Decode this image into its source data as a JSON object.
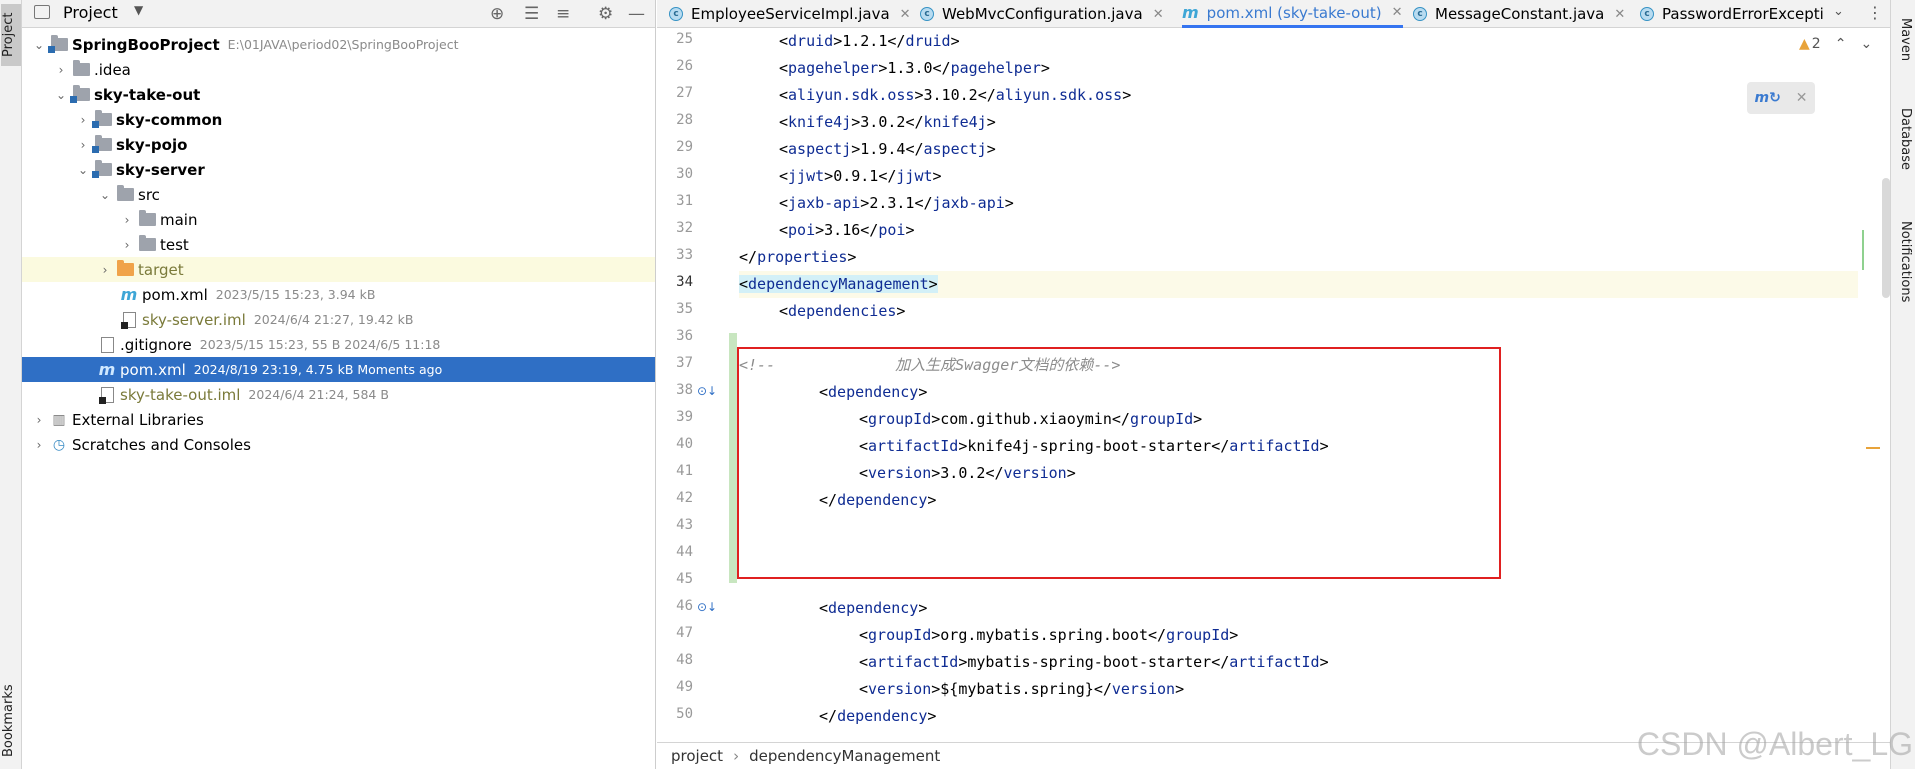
{
  "left_strip": {
    "project": "Project",
    "bookmarks": "Bookmarks"
  },
  "project_panel": {
    "title": "Project"
  },
  "tree": [
    {
      "label": "SpringBooProject",
      "meta": "E:\\01JAVA\\period02\\SpringBooProject",
      "icon": "module-folder-icon",
      "bold": true
    },
    {
      "label": ".idea",
      "meta": "",
      "icon": "folder-icon"
    },
    {
      "label": "sky-take-out",
      "meta": "",
      "icon": "module-folder-icon",
      "bold": true
    },
    {
      "label": "sky-common",
      "meta": "",
      "icon": "module-folder-icon",
      "bold": true
    },
    {
      "label": "sky-pojo",
      "meta": "",
      "icon": "module-folder-icon",
      "bold": true
    },
    {
      "label": "sky-server",
      "meta": "",
      "icon": "module-folder-icon",
      "bold": true
    },
    {
      "label": "src",
      "meta": "",
      "icon": "folder-icon"
    },
    {
      "label": "main",
      "meta": "",
      "icon": "folder-icon"
    },
    {
      "label": "test",
      "meta": "",
      "icon": "folder-icon"
    },
    {
      "label": "target",
      "meta": "",
      "icon": "target-folder-icon"
    },
    {
      "label": "pom.xml",
      "meta": "2023/5/15 15:23, 3.94 kB",
      "icon": "maven-file-icon"
    },
    {
      "label": "sky-server.iml",
      "meta": "2024/6/4 21:27, 19.42 kB",
      "icon": "iml-file-icon"
    },
    {
      "label": ".gitignore",
      "meta": "2023/5/15 15:23, 55 B 2024/6/5 11:18",
      "icon": "gitignore-file-icon"
    },
    {
      "label": "pom.xml",
      "meta": "2024/8/19 23:19, 4.75 kB Moments ago",
      "icon": "maven-file-icon"
    },
    {
      "label": "sky-take-out.iml",
      "meta": "2024/6/4 21:24, 584 B",
      "icon": "iml-file-icon"
    },
    {
      "label": "External Libraries",
      "meta": "",
      "icon": "libraries-icon"
    },
    {
      "label": "Scratches and Consoles",
      "meta": "",
      "icon": "scratches-icon"
    }
  ],
  "tabs": [
    {
      "label": "EmployeeServiceImpl.java",
      "icon": "class-icon"
    },
    {
      "label": "WebMvcConfiguration.java",
      "icon": "class-icon"
    },
    {
      "label": "pom.xml (sky-take-out)",
      "icon": "maven-file-icon",
      "active": true
    },
    {
      "label": "MessageConstant.java",
      "icon": "class-icon"
    },
    {
      "label": "PasswordErrorExcepti",
      "icon": "class-icon"
    }
  ],
  "warnings": {
    "count": "2"
  },
  "line_numbers": [
    "25",
    "26",
    "27",
    "28",
    "29",
    "30",
    "31",
    "32",
    "33",
    "34",
    "35",
    "36",
    "37",
    "38",
    "39",
    "40",
    "41",
    "42",
    "43",
    "44",
    "45",
    "46",
    "47",
    "48",
    "49",
    "50"
  ],
  "code": {
    "l25": {
      "tag1": "druid",
      "val": "1.2.1",
      "tag2": "druid"
    },
    "l26": {
      "tag1": "pagehelper",
      "val": "1.3.0",
      "tag2": "pagehelper"
    },
    "l27": {
      "tag1": "aliyun.sdk.oss",
      "val": "3.10.2",
      "tag2": "aliyun.sdk.oss"
    },
    "l28": {
      "tag1": "knife4j",
      "val": "3.0.2",
      "tag2": "knife4j"
    },
    "l29": {
      "tag1": "aspectj",
      "val": "1.9.4",
      "tag2": "aspectj"
    },
    "l30": {
      "tag1": "jjwt",
      "val": "0.9.1",
      "tag2": "jjwt"
    },
    "l31": {
      "tag1": "jaxb-api",
      "val": "2.3.1",
      "tag2": "jaxb-api"
    },
    "l32": {
      "tag1": "poi",
      "val": "3.16",
      "tag2": "poi"
    },
    "l33": {
      "tag": "properties"
    },
    "l34": {
      "tag": "dependencyManagement"
    },
    "l35": {
      "tag": "dependencies"
    },
    "l37": {
      "open": "<!--",
      "text": "加入生成Swagger文档的依赖-->"
    },
    "l38": {
      "tag": "dependency"
    },
    "l39": {
      "tag1": "groupId",
      "val": "com.github.xiaoymin",
      "tag2": "groupId"
    },
    "l40": {
      "tag1": "artifactId",
      "val": "knife4j-spring-boot-starter",
      "tag2": "artifactId"
    },
    "l41": {
      "tag1": "version",
      "val": "3.0.2",
      "tag2": "version"
    },
    "l42": {
      "tag": "dependency"
    },
    "l46": {
      "tag": "dependency"
    },
    "l47": {
      "tag1": "groupId",
      "val": "org.mybatis.spring.boot",
      "tag2": "groupId"
    },
    "l48": {
      "tag1": "artifactId",
      "val": "mybatis-spring-boot-starter",
      "tag2": "artifactId"
    },
    "l49": {
      "tag1": "version",
      "val": "${mybatis.spring}",
      "tag2": "version"
    },
    "l50": {
      "tag": "dependency"
    }
  },
  "breadcrumb": [
    "project",
    "dependencyManagement"
  ],
  "right_strip": {
    "maven": "Maven",
    "database": "Database",
    "notifications": "Notifications"
  },
  "watermark": "CSDN @Albert_LG",
  "colors": {
    "selection": "#2f6fc5",
    "tag": "#0f2c93",
    "annotation_box": "#e02020",
    "active_tab_underline": "#3574f0"
  }
}
